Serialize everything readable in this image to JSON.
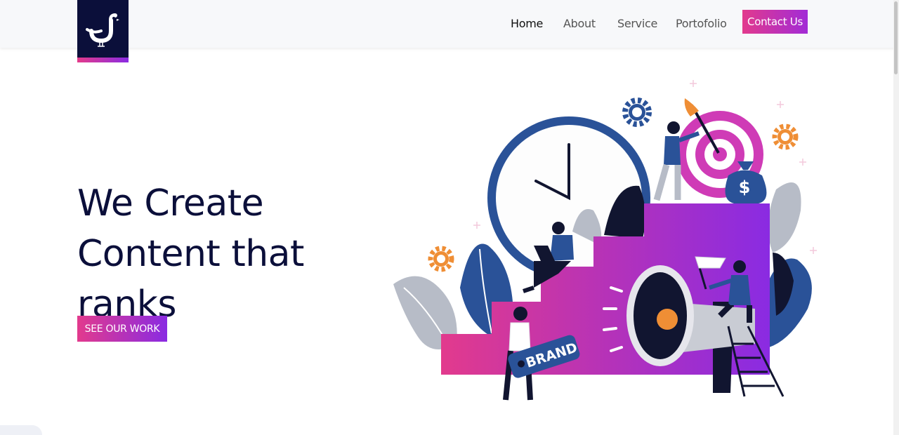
{
  "header": {
    "logo_alt": "logo",
    "nav": [
      {
        "label": "Home"
      },
      {
        "label": "About"
      },
      {
        "label": "Service"
      },
      {
        "label": "Portofolio"
      }
    ],
    "contact_label": "Contact Us"
  },
  "hero": {
    "title_line1": "We Create",
    "title_line2": "Content that",
    "title_line3": "ranks",
    "cta_label": "SEE OUR WORK",
    "illustration_text": "BRAND"
  },
  "colors": {
    "navy": "#0b0f3a",
    "accent_pink": "#e23a8d",
    "accent_purple": "#8a2be2",
    "blue": "#2a5298",
    "orange": "#ef8e35"
  }
}
